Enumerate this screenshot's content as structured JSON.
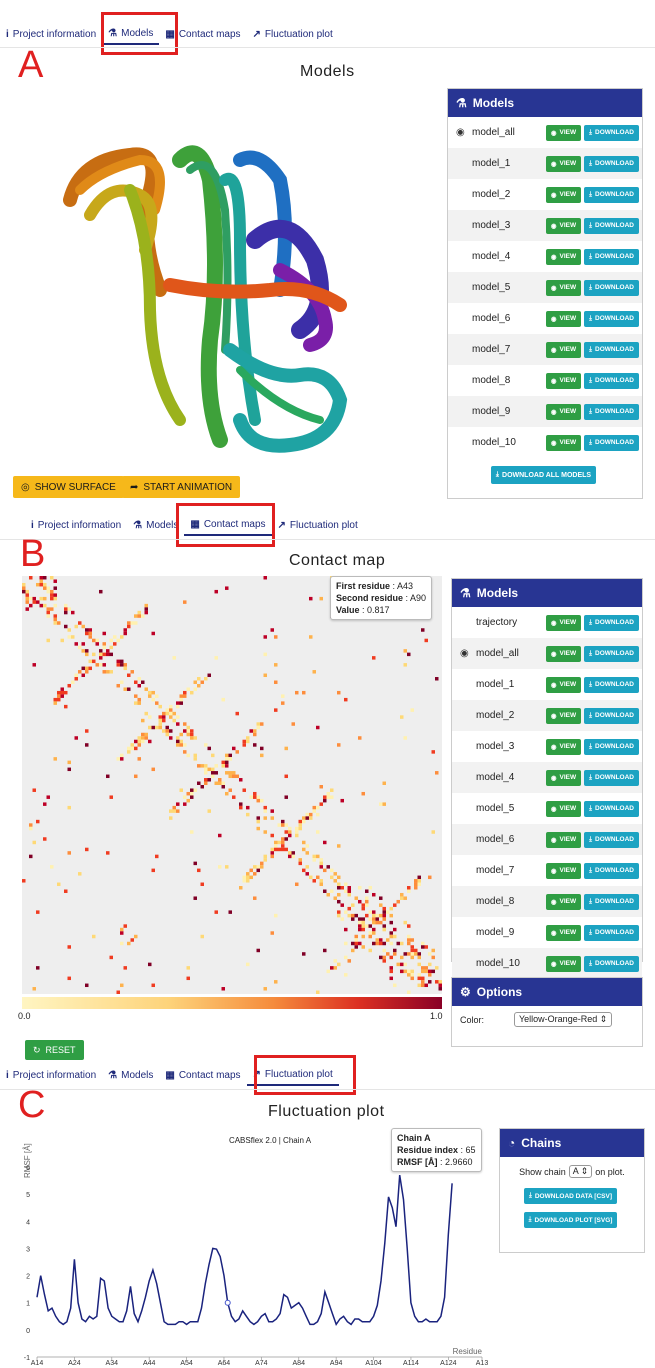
{
  "nav": {
    "project_information": "Project information",
    "models": "Models",
    "contact_maps": "Contact maps",
    "fluctuation_plot": "Fluctuation plot"
  },
  "labels": {
    "a": "A",
    "b": "B",
    "c": "C"
  },
  "models_section": {
    "title": "Models",
    "panel_title": "Models",
    "rows": [
      "model_all",
      "model_1",
      "model_2",
      "model_3",
      "model_4",
      "model_5",
      "model_6",
      "model_7",
      "model_8",
      "model_9",
      "model_10"
    ],
    "view_label": "VIEW",
    "download_label": "DOWNLOAD",
    "download_all_label": "DOWNLOAD ALL MODELS",
    "show_surface_label": "SHOW SURFACE",
    "start_animation_label": "START ANIMATION"
  },
  "contact_section": {
    "title": "Contact map",
    "tooltip": {
      "first_label": "First residue",
      "first_value": "A43",
      "second_label": "Second residue",
      "second_value": "A90",
      "value_label": "Value",
      "value_value": "0.817"
    },
    "panel_title": "Models",
    "rows": [
      "trajectory",
      "model_all",
      "model_1",
      "model_2",
      "model_3",
      "model_4",
      "model_5",
      "model_6",
      "model_7",
      "model_8",
      "model_9",
      "model_10"
    ],
    "view_label": "VIEW",
    "download_label": "DOWNLOAD",
    "scale_min": "0.0",
    "scale_max": "1.0",
    "options_title": "Options",
    "color_label": "Color:",
    "color_value": "Yellow-Orange-Red",
    "reset_label": "RESET"
  },
  "fluct_section": {
    "title": "Fluctuation plot",
    "panel_title": "Chains",
    "show_chain_prefix": "Show chain",
    "chain_value": "A",
    "show_chain_suffix": "on plot.",
    "download_data_label": "DOWNLOAD DATA [CSV]",
    "download_plot_label": "DOWNLOAD PLOT [SVG]",
    "tooltip": {
      "chain": "Chain A",
      "index_label": "Residue index",
      "index_value": "65",
      "rmsf_label": "RMSF [Å]",
      "rmsf_value": "2.9660"
    }
  },
  "chart_data": {
    "type": "line",
    "title": "CABSflex 2.0 | Chain A",
    "xlabel": "Residue",
    "ylabel": "RMSF [Å]",
    "ylim": [
      -1,
      6
    ],
    "yticks": [
      "-1",
      "0",
      "1",
      "2",
      "3",
      "4",
      "5",
      "6"
    ],
    "xticks": [
      "A14",
      "A24",
      "A34",
      "A44",
      "A54",
      "A64",
      "A74",
      "A84",
      "A94",
      "A104",
      "A114",
      "A124",
      "A13"
    ],
    "x": [
      14,
      15,
      16,
      17,
      18,
      19,
      20,
      21,
      22,
      23,
      24,
      25,
      26,
      27,
      28,
      29,
      30,
      31,
      32,
      33,
      34,
      35,
      36,
      37,
      38,
      39,
      40,
      41,
      42,
      43,
      44,
      45,
      46,
      47,
      48,
      49,
      50,
      51,
      52,
      53,
      54,
      55,
      56,
      57,
      58,
      59,
      60,
      61,
      62,
      63,
      64,
      65,
      66,
      67,
      68,
      69,
      70,
      71,
      72,
      73,
      74,
      75,
      76,
      77,
      78,
      79,
      80,
      81,
      82,
      83,
      84,
      85,
      86,
      87,
      88,
      89,
      90,
      91,
      92,
      93,
      94,
      95,
      96,
      97,
      98,
      99,
      100,
      101,
      102,
      103,
      104,
      105,
      106,
      107,
      108,
      109,
      110,
      111,
      112,
      113,
      114,
      115,
      116,
      117,
      118,
      119,
      120,
      121,
      122,
      123,
      124,
      125,
      126,
      127,
      128,
      129,
      130,
      131,
      132,
      133
    ],
    "series": [
      {
        "color": "#1a237e",
        "values": [
          1.2,
          2.0,
          1.3,
          0.7,
          0.8,
          0.5,
          0.3,
          0.2,
          0.3,
          0.8,
          2.6,
          1.0,
          0.4,
          0.3,
          0.5,
          0.4,
          0.5,
          1.9,
          1.8,
          0.8,
          0.5,
          0.4,
          0.3,
          0.3,
          0.7,
          1.6,
          0.6,
          0.3,
          0.7,
          1.2,
          1.8,
          2.2,
          1.7,
          1.0,
          0.3,
          0.2,
          0.2,
          0.2,
          0.3,
          0.3,
          0.2,
          0.3,
          0.3,
          0.3,
          0.8,
          1.7,
          2.4,
          3.0,
          2.97,
          2.7,
          2.0,
          1.0,
          0.5,
          0.3,
          0.4,
          0.7,
          0.5,
          0.3,
          0.2,
          0.3,
          0.5,
          0.6,
          0.3,
          0.3,
          0.4,
          0.6,
          1.3,
          1.2,
          0.8,
          0.9,
          1.0,
          0.8,
          0.5,
          0.2,
          0.2,
          0.3,
          0.6,
          1.4,
          1.0,
          0.6,
          0.2,
          0.4,
          0.5,
          0.3,
          0.2,
          0.4,
          0.4,
          0.3,
          0.3,
          0.3,
          0.5,
          0.9,
          1.8,
          3.2,
          4.9,
          4.5,
          3.8,
          5.7,
          4.8,
          3.0,
          1.0,
          0.5,
          0.3,
          0.3,
          0.4,
          0.3,
          0.3,
          0.3,
          0.5,
          1.2,
          3.5,
          5.4
        ]
      }
    ]
  }
}
